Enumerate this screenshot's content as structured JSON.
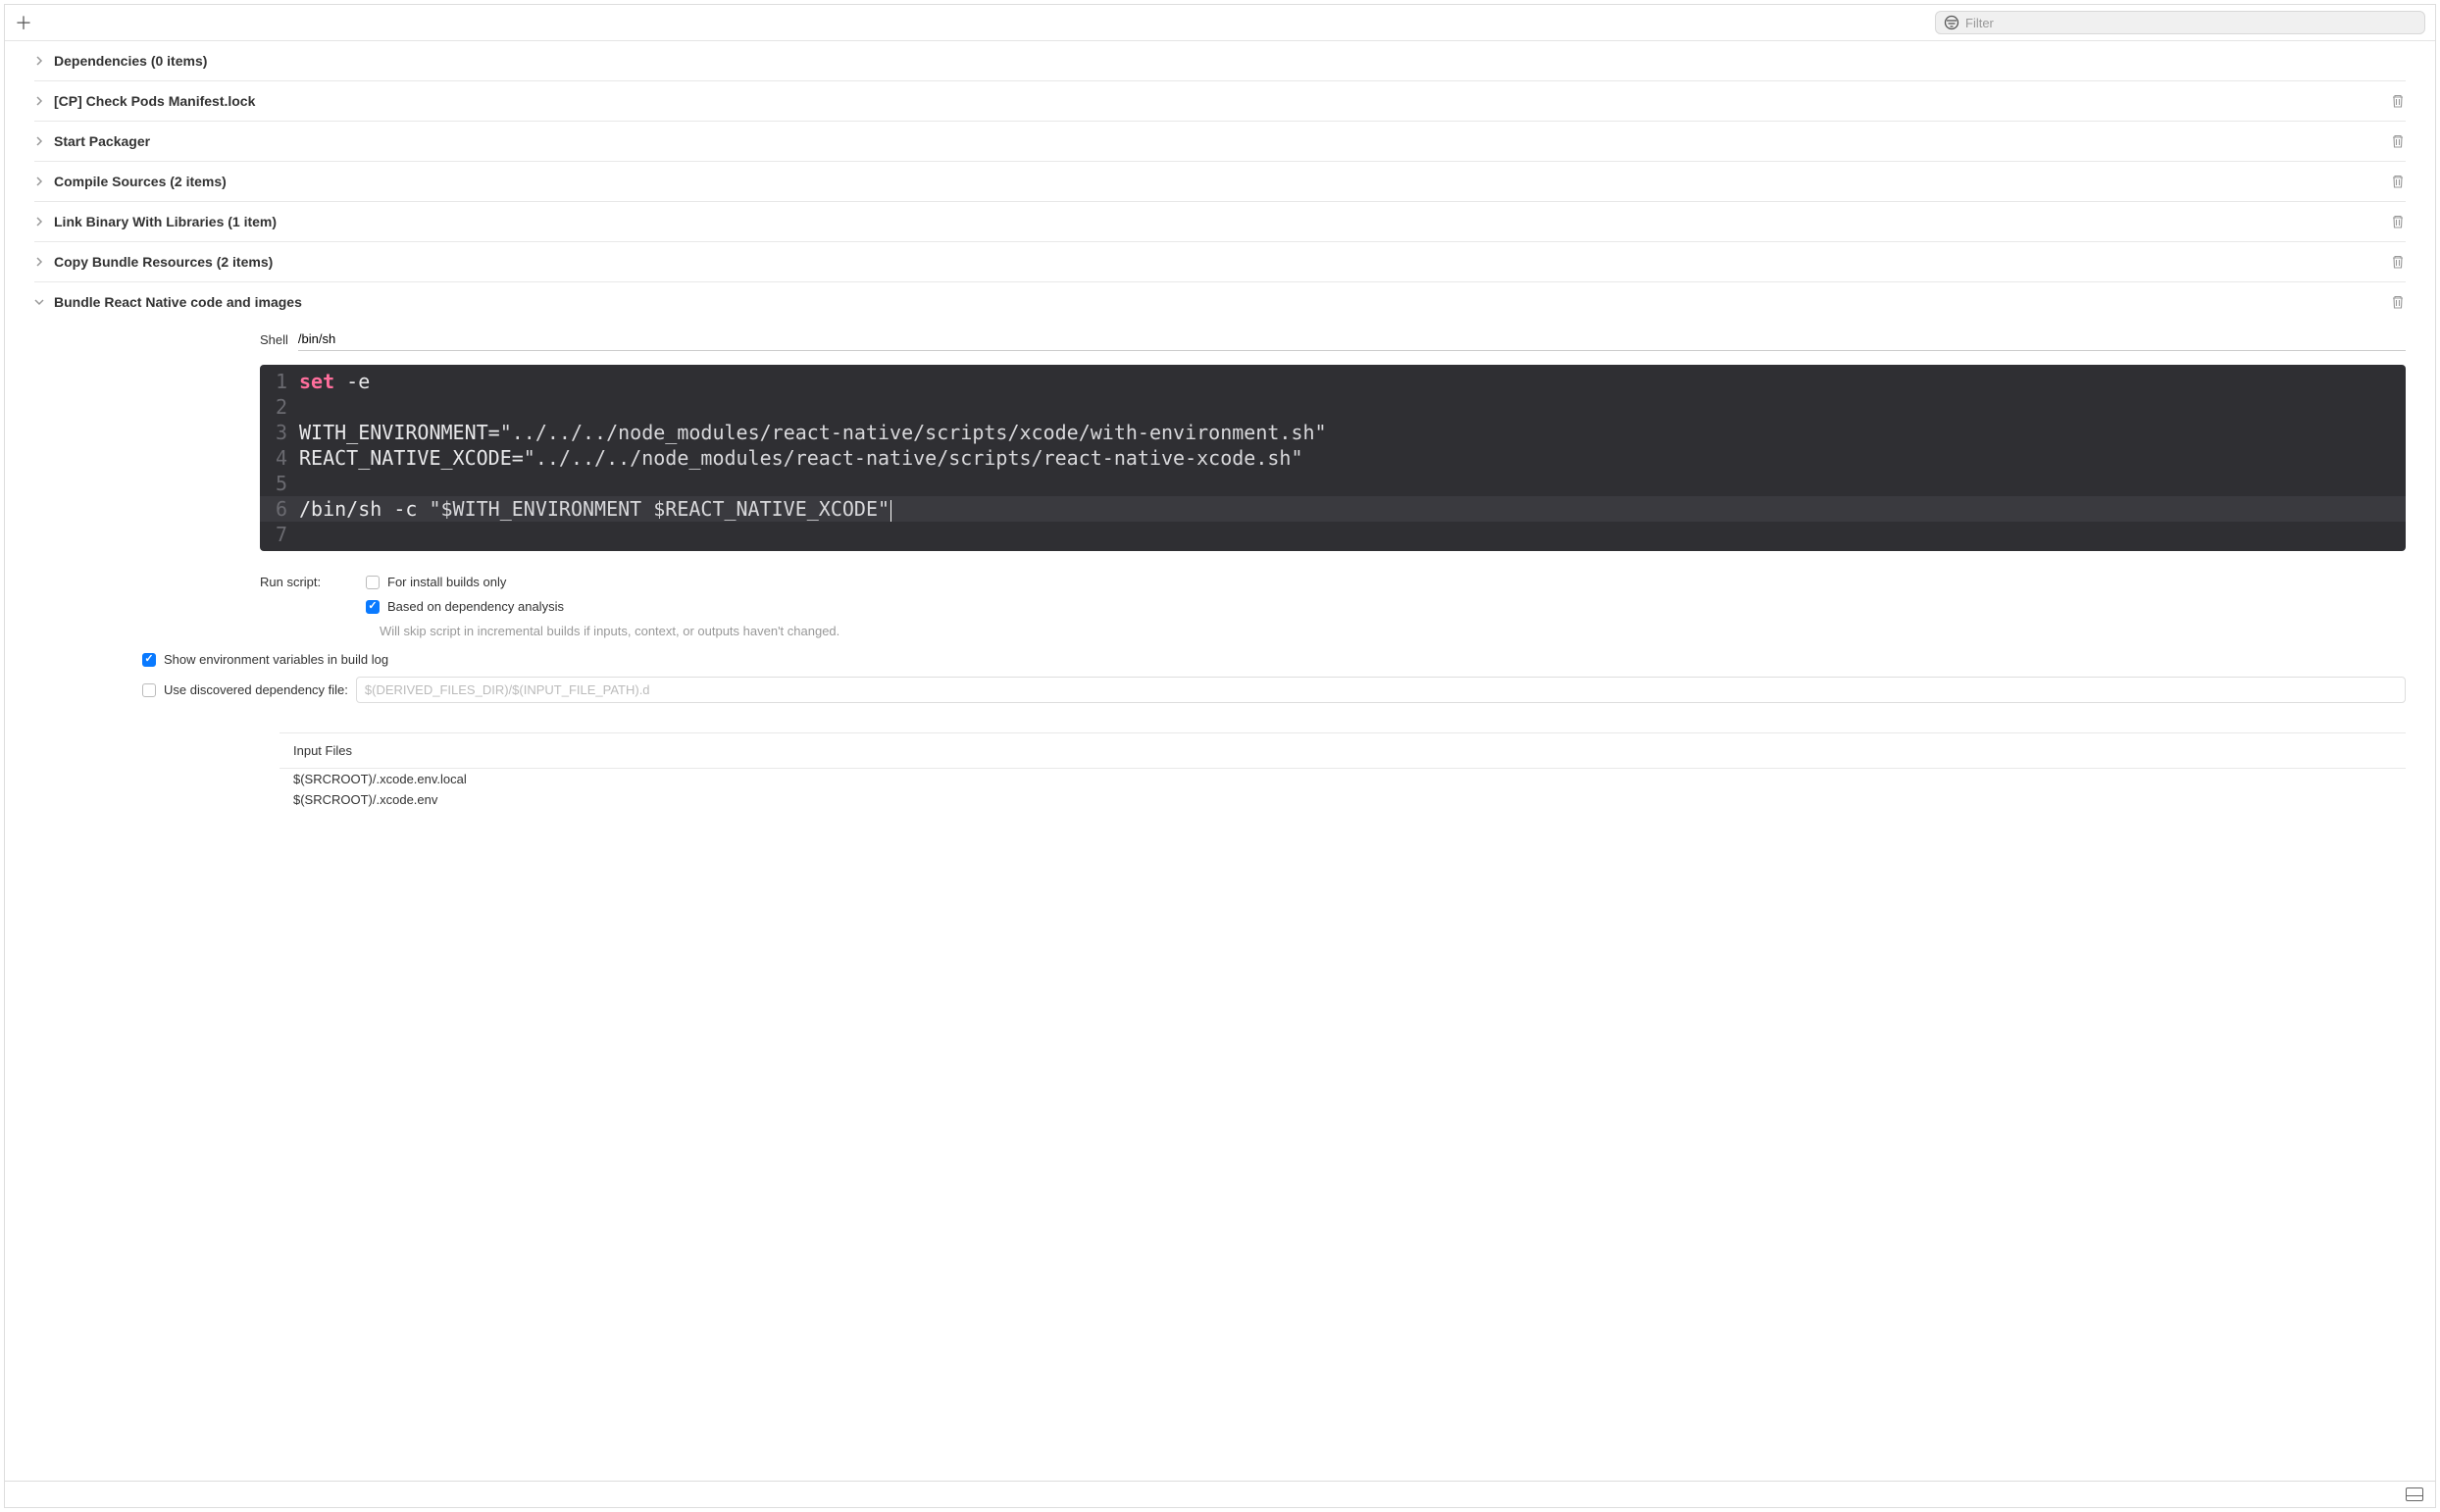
{
  "toolbar": {
    "filter_placeholder": "Filter"
  },
  "phases": {
    "dependencies": "Dependencies (0 items)",
    "check_pods": "[CP] Check Pods Manifest.lock",
    "start_packager": "Start Packager",
    "compile_sources": "Compile Sources (2 items)",
    "link_binary": "Link Binary With Libraries (1 item)",
    "copy_bundle": "Copy Bundle Resources (2 items)",
    "bundle_rn": "Bundle React Native code and images"
  },
  "shell": {
    "label": "Shell",
    "value": "/bin/sh"
  },
  "code": {
    "line1_keyword": "set",
    "line1_rest": " -e",
    "line3_var": "WITH_ENVIRONMENT=",
    "line3_str": "\"../../../node_modules/react-native/scripts/xcode/with-environment.sh\"",
    "line4_var": "REACT_NATIVE_XCODE=",
    "line4_str": "\"../../../node_modules/react-native/scripts/react-native-xcode.sh\"",
    "line6_cmd": "/bin/sh -c ",
    "line6_str": "\"$WITH_ENVIRONMENT $REACT_NATIVE_XCODE\""
  },
  "options": {
    "run_script_label": "Run script:",
    "install_builds": "For install builds only",
    "dependency_analysis": "Based on dependency analysis",
    "dependency_hint": "Will skip script in incremental builds if inputs, context, or outputs haven't changed.",
    "show_env": "Show environment variables in build log",
    "discovered_dep": "Use discovered dependency file:",
    "discovered_dep_placeholder": "$(DERIVED_FILES_DIR)/$(INPUT_FILE_PATH).d"
  },
  "input_files": {
    "header": "Input Files",
    "items": [
      "$(SRCROOT)/.xcode.env.local",
      "$(SRCROOT)/.xcode.env"
    ]
  }
}
